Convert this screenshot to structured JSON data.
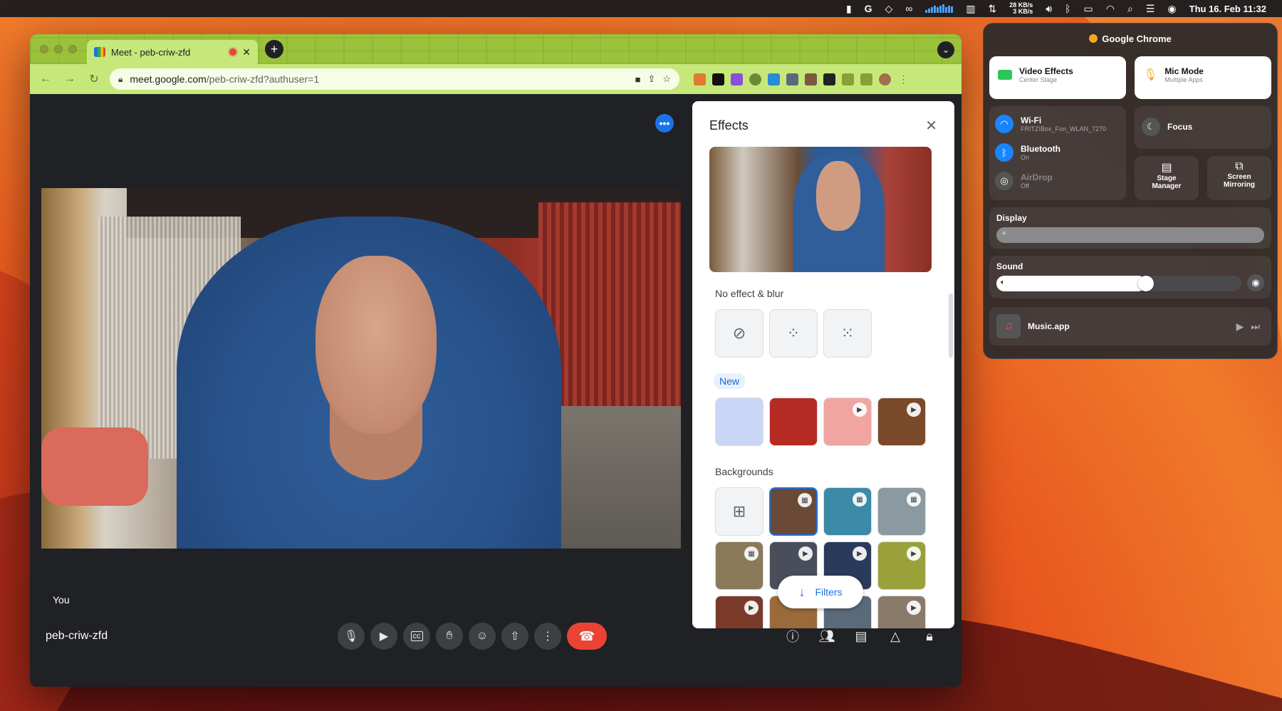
{
  "menubar": {
    "net_up": "28 KB/s",
    "net_down": "3 KB/s",
    "clock": "Thu 16. Feb  11:32"
  },
  "browser": {
    "tab_title": "Meet - peb-criw-zfd",
    "url_host": "meet.google.com",
    "url_path": "/peb-criw-zfd?authuser=1"
  },
  "meet": {
    "self_label": "You",
    "meeting_code": "peb-criw-zfd",
    "participants_badge": "1"
  },
  "effects": {
    "title": "Effects",
    "section_blur": "No effect & blur",
    "new_chip": "New",
    "section_backgrounds": "Backgrounds",
    "filters_label": "Filters"
  },
  "control_center": {
    "app_name": "Google Chrome",
    "video_effects": {
      "title": "Video Effects",
      "subtitle": "Center Stage"
    },
    "mic_mode": {
      "title": "Mic Mode",
      "subtitle": "Multiple Apps"
    },
    "wifi": {
      "title": "Wi-Fi",
      "subtitle": "FRITZ!Box_Fon_WLAN_7270"
    },
    "bluetooth": {
      "title": "Bluetooth",
      "subtitle": "On"
    },
    "airdrop": {
      "title": "AirDrop",
      "subtitle": "Off"
    },
    "focus": "Focus",
    "stage_manager": "Stage\nManager",
    "screen_mirroring": "Screen\nMirroring",
    "display_label": "Display",
    "display_level": 1.0,
    "sound_label": "Sound",
    "sound_level": 0.61,
    "music_app": "Music.app"
  },
  "colors": {
    "meet_dark": "#202124",
    "accent_blue": "#1a73e8",
    "end_call_red": "#ea4335",
    "tab_green": "#9bc23b"
  }
}
